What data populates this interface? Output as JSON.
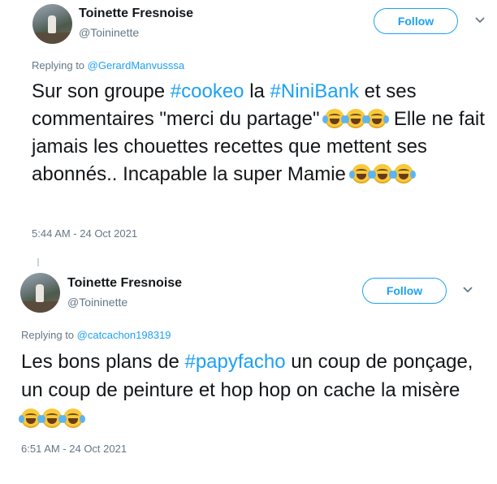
{
  "tweets": [
    {
      "name": "Toinette Fresnoise",
      "handle": "@Toininette",
      "follow_label": "Follow",
      "reply_prefix": "Replying to",
      "reply_mention": "@GerardManvusssa",
      "body": {
        "p1": "Sur son groupe ",
        "tag1": "#cookeo",
        "p2": " la ",
        "tag2": "#NiniBank",
        "p3": " et ses commentaires \"merci du partage\" ",
        "p4": " Elle ne fait jamais les chouettes recettes que mettent ses abonnés.. Incapable la super Mamie "
      },
      "timestamp": "5:44 AM - 24 Oct 2021"
    },
    {
      "name": "Toinette Fresnoise",
      "handle": "@Toininette",
      "follow_label": "Follow",
      "reply_prefix": "Replying to",
      "reply_mention": "@catcachon198319",
      "body": {
        "p1": "Les bons plans de ",
        "tag1": "#papyfacho",
        "p2": " un coup de ponçage, un coup de peinture et hop hop on cache la misère "
      },
      "timestamp": "6:51 AM - 24 Oct 2021"
    }
  ],
  "icons": {
    "emoji": "face-with-tears-of-joy",
    "menu": "chevron-down-icon"
  },
  "colors": {
    "accent": "#1da1f2",
    "text": "#14171a",
    "muted": "#657786"
  }
}
